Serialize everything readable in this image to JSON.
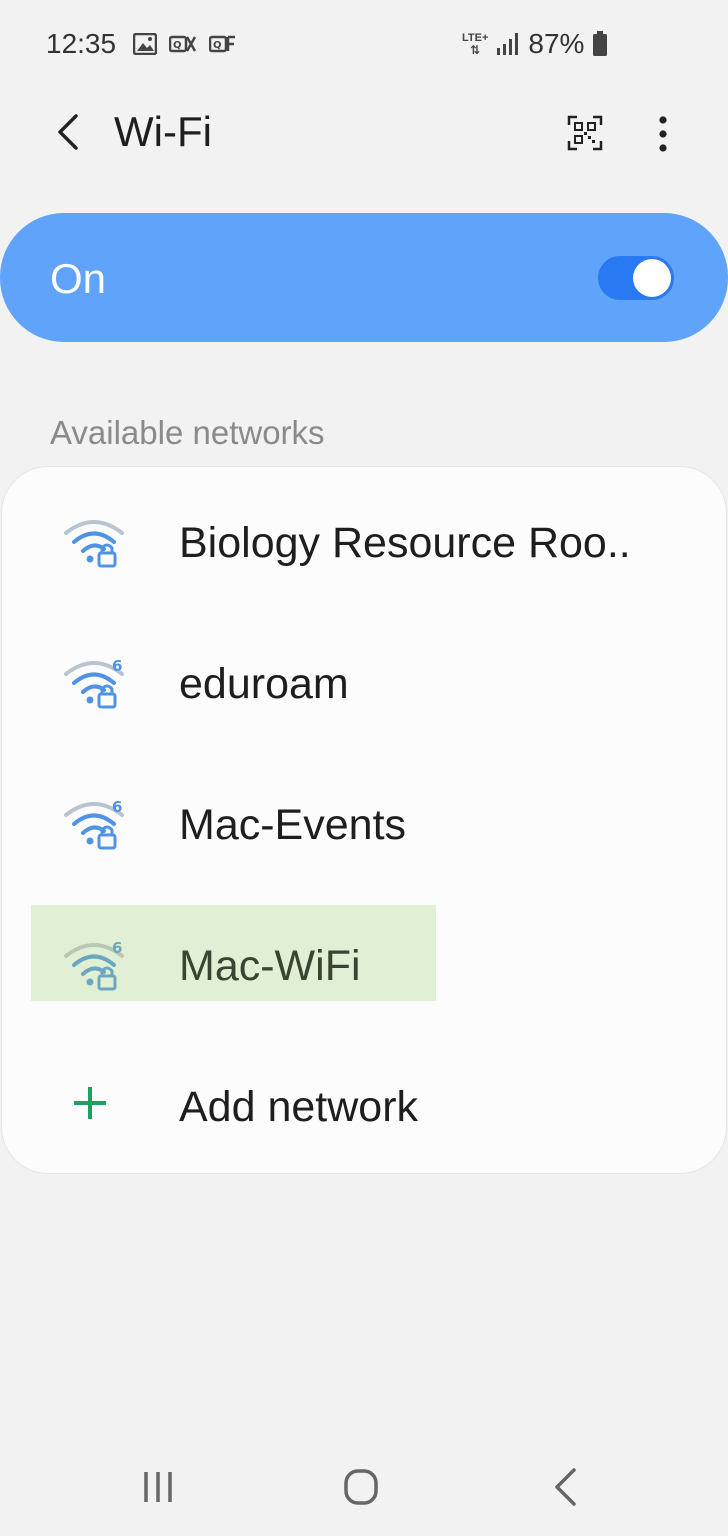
{
  "status_bar": {
    "time": "12:35",
    "network_type": "LTE+",
    "battery": "87%",
    "icons": [
      "image-notification-icon",
      "qk-notification-icon",
      "qf-notification-icon",
      "signal-icon",
      "battery-icon"
    ]
  },
  "header": {
    "title": "Wi-Fi",
    "icons": [
      "back-arrow-icon",
      "qr-code-icon",
      "more-options-icon"
    ]
  },
  "wifi_toggle": {
    "label": "On",
    "state": true,
    "color": "#5fa3fa",
    "toggle_color": "#2979f2"
  },
  "section": {
    "label": "Available networks"
  },
  "networks": [
    {
      "name": "Biology Resource Roo..",
      "secured": true,
      "wifi6": false
    },
    {
      "name": "eduroam",
      "secured": true,
      "wifi6": true
    },
    {
      "name": "Mac-Events",
      "secured": true,
      "wifi6": true
    },
    {
      "name": "Mac-WiFi",
      "secured": true,
      "wifi6": true,
      "highlighted": true,
      "highlight_color": "#dfefd2"
    }
  ],
  "add_network": {
    "label": "Add network",
    "icon": "plus-icon",
    "color": "#1aa260"
  },
  "nav_bar": {
    "icons": [
      "recent-apps-icon",
      "home-icon",
      "back-icon"
    ]
  }
}
